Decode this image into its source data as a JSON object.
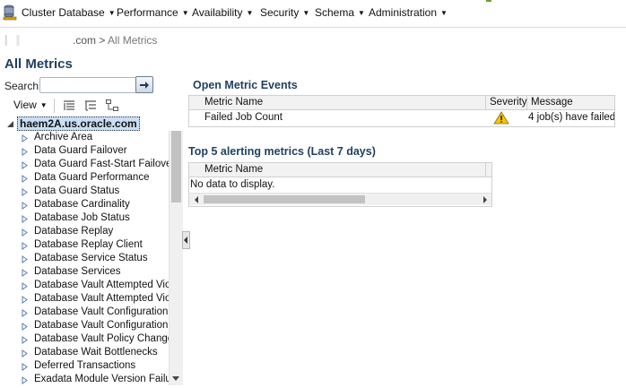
{
  "menubar": {
    "items": [
      {
        "label": "Cluster Database"
      },
      {
        "label": "Performance"
      },
      {
        "label": "Availability"
      },
      {
        "label": "Security"
      },
      {
        "label": "Schema"
      },
      {
        "label": "Administration"
      }
    ]
  },
  "breadcrumb": {
    "host_suffix": ".com",
    "separator": ">",
    "current": "All Metrics"
  },
  "page": {
    "title": "All Metrics"
  },
  "search": {
    "label": "Search",
    "value": ""
  },
  "tree_toolbar": {
    "view_label": "View"
  },
  "tree": {
    "root": "haem2A.us.oracle.com",
    "items": [
      "Archive Area",
      "Data Guard Failover",
      "Data Guard Fast-Start Failover",
      "Data Guard Performance",
      "Data Guard Status",
      "Database Cardinality",
      "Database Job Status",
      "Database Replay",
      "Database Replay Client",
      "Database Service Status",
      "Database Services",
      "Database Vault Attempted Vio",
      "Database Vault Attempted Vio",
      "Database Vault Configuration",
      "Database Vault Configuration",
      "Database Vault Policy Changes",
      "Database Wait Bottlenecks",
      "Deferred Transactions",
      "Exadata Module Version Failur"
    ]
  },
  "open_events": {
    "title": "Open Metric Events",
    "columns": {
      "metric_name": "Metric Name",
      "severity": "Severity",
      "message": "Message"
    },
    "rows": [
      {
        "metric_name": "Failed Job Count",
        "severity": "warning-icon",
        "message": "4 job(s) have failed"
      }
    ]
  },
  "top_alerts": {
    "title": "Top 5 alerting metrics (Last 7 days)",
    "columns": {
      "metric_name": "Metric Name"
    },
    "empty_text": "No data to display."
  },
  "colors": {
    "title": "#1f3f5f",
    "selected_bg": "#c9dff5",
    "warning": "#f5c400"
  }
}
